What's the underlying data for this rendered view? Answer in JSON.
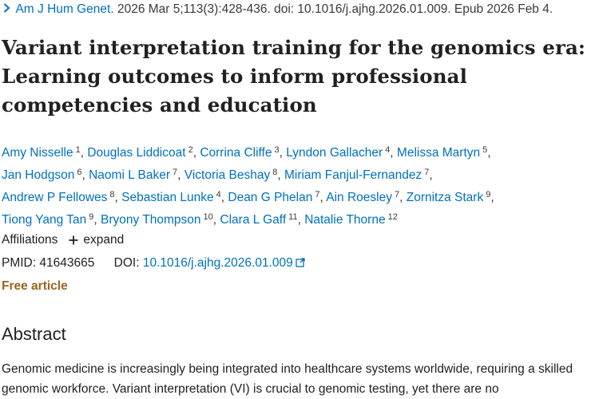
{
  "citation": {
    "journal": "Am J Hum Genet.",
    "details": "2026 Mar 5;113(3):428-436. doi: 10.1016/j.ajhg.2026.01.009. Epub 2026 Feb 4."
  },
  "title": "Variant interpretation training for the genomics era: Learning outcomes to inform professional competencies and education",
  "authors": [
    {
      "name": "Amy Nisselle",
      "aff": "1"
    },
    {
      "name": "Douglas Liddicoat",
      "aff": "2"
    },
    {
      "name": "Corrina Cliffe",
      "aff": "3"
    },
    {
      "name": "Lyndon Gallacher",
      "aff": "4"
    },
    {
      "name": "Melissa Martyn",
      "aff": "5"
    },
    {
      "name": "Jan Hodgson",
      "aff": "6"
    },
    {
      "name": "Naomi L Baker",
      "aff": "7"
    },
    {
      "name": "Victoria Beshay",
      "aff": "8"
    },
    {
      "name": "Miriam Fanjul-Fernandez",
      "aff": "7"
    },
    {
      "name": "Andrew P Fellowes",
      "aff": "8"
    },
    {
      "name": "Sebastian Lunke",
      "aff": "4"
    },
    {
      "name": "Dean G Phelan",
      "aff": "7"
    },
    {
      "name": "Ain Roesley",
      "aff": "7"
    },
    {
      "name": "Zornitza Stark",
      "aff": "9"
    },
    {
      "name": "Tiong Yang Tan",
      "aff": "9"
    },
    {
      "name": "Bryony Thompson",
      "aff": "10"
    },
    {
      "name": "Clara L Gaff",
      "aff": "11"
    },
    {
      "name": "Natalie Thorne",
      "aff": "12"
    }
  ],
  "affiliations": {
    "label": "Affiliations",
    "expand_label": "expand"
  },
  "identifiers": {
    "pmid_label": "PMID:",
    "pmid": "41643665",
    "doi_label": "DOI:",
    "doi": "10.1016/j.ajhg.2026.01.009"
  },
  "free_article": "Free article",
  "abstract": {
    "heading": "Abstract",
    "text": "Genomic medicine is increasingly being integrated into healthcare systems worldwide, requiring a skilled genomic workforce. Variant interpretation (VI) is crucial to genomic testing, yet there are no"
  },
  "colors": {
    "link": "#0071bc",
    "free_article": "#a0621d",
    "text": "#212121"
  }
}
